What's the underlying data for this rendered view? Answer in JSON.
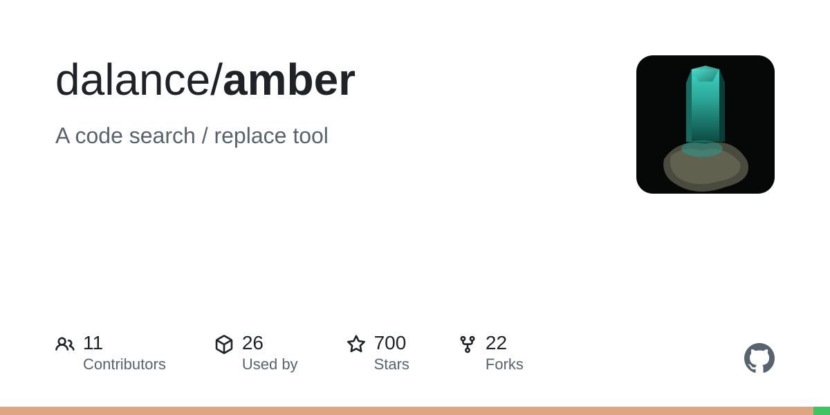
{
  "repo": {
    "owner": "dalance",
    "name": "amber",
    "description": "A code search / replace tool"
  },
  "stats": {
    "contributors": {
      "count": "11",
      "label": "Contributors"
    },
    "usedby": {
      "count": "26",
      "label": "Used by"
    },
    "stars": {
      "count": "700",
      "label": "Stars"
    },
    "forks": {
      "count": "22",
      "label": "Forks"
    }
  },
  "languages": {
    "primary_pct": 98,
    "other_pct": 2
  }
}
